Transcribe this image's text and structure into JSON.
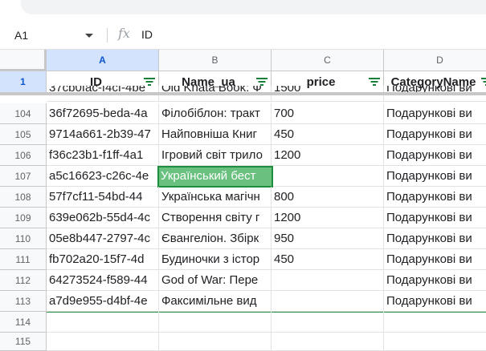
{
  "formula_bar": {
    "name_box": "A1",
    "fx": "fx",
    "value": "ID"
  },
  "columns": [
    "A",
    "B",
    "C",
    "D"
  ],
  "header_row": {
    "row_number": "1",
    "cells": [
      "ID",
      "Name_ua",
      "price",
      "CategoryName"
    ]
  },
  "partial_row": {
    "cells": [
      "37cb0fac-f4cf-4be",
      "Old Khata Book: Ф",
      "1500",
      "Подарункові ви"
    ]
  },
  "rows": [
    {
      "num": "104",
      "cells": [
        "36f72695-beda-4a",
        "Філобіблон: тракт",
        "700",
        "Подарункові ви"
      ]
    },
    {
      "num": "105",
      "cells": [
        "9714a661-2b39-47",
        "Найповніша Книг",
        "450",
        "Подарункові ви"
      ]
    },
    {
      "num": "106",
      "cells": [
        "f36c23b1-f1ff-4a1",
        "Ігровий світ трило",
        "1200",
        "Подарункові ви"
      ]
    },
    {
      "num": "107",
      "cells": [
        "a5c16623-c26c-4e",
        "Український бест",
        "",
        "Подарункові ви"
      ]
    },
    {
      "num": "108",
      "cells": [
        "57f7cf11-54bd-44",
        "Українська магічн",
        "800",
        "Подарункові ви"
      ]
    },
    {
      "num": "109",
      "cells": [
        "639e062b-55d4-4c",
        "Створення світу г",
        "1200",
        "Подарункові ви"
      ]
    },
    {
      "num": "110",
      "cells": [
        "05e8b447-2797-4c",
        "Євангеліон. Збірк",
        "950",
        "Подарункові ви"
      ]
    },
    {
      "num": "111",
      "cells": [
        "fb702a20-15f7-4d",
        "Будиночки з істор",
        "450",
        "Подарункові ви"
      ]
    },
    {
      "num": "112",
      "cells": [
        "64273524-f589-44",
        "God of War: Пере",
        "",
        "Подарункові ви"
      ]
    },
    {
      "num": "113",
      "cells": [
        "a7d9e955-d4bf-4e",
        "Факсимільне вид",
        "",
        "Подарункові ви"
      ]
    }
  ],
  "empty_rows": [
    "114",
    "115"
  ],
  "colors": {
    "header_bg": "#f8f9fa",
    "selected_header": "#d3e3fd",
    "selected_cell": "#6ac07f",
    "filter_icon": "#188038"
  }
}
